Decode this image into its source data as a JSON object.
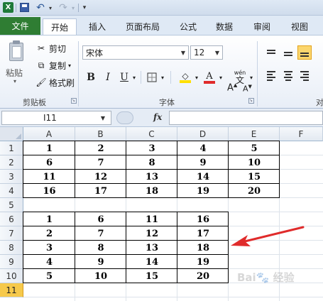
{
  "quick_access": {
    "logo": "X",
    "undo_icon": "undo-icon",
    "redo_icon": "redo-icon"
  },
  "tabs": {
    "file": "文件",
    "items": [
      "开始",
      "插入",
      "页面布局",
      "公式",
      "数据",
      "审阅",
      "视图"
    ],
    "active": "开始"
  },
  "ribbon": {
    "clipboard": {
      "paste": "粘贴",
      "cut": "剪切",
      "copy": "复制",
      "copy_dropdown": "▾",
      "format_painter": "格式刷",
      "group_label": "剪贴板"
    },
    "font": {
      "font_name": "宋体",
      "font_size": "12",
      "grow": "A",
      "shrink": "A",
      "bold": "B",
      "italic": "I",
      "underline": "U",
      "fill_letter": "A",
      "phonetic": "wén",
      "phonetic_char": "文",
      "group_label": "字体"
    },
    "alignment": {
      "group_label_partial": "对"
    }
  },
  "formula_bar": {
    "name_box": "I11",
    "fx": "fx",
    "value": ""
  },
  "sheet": {
    "columns": [
      "A",
      "B",
      "C",
      "D",
      "E",
      "F"
    ],
    "rows": [
      "1",
      "2",
      "3",
      "4",
      "5",
      "6",
      "7",
      "8",
      "9",
      "10",
      "11"
    ],
    "selected_row": "11",
    "table1": [
      [
        "1",
        "2",
        "3",
        "4",
        "5"
      ],
      [
        "6",
        "7",
        "8",
        "9",
        "10"
      ],
      [
        "11",
        "12",
        "13",
        "14",
        "15"
      ],
      [
        "16",
        "17",
        "18",
        "19",
        "20"
      ]
    ],
    "table2": [
      [
        "1",
        "6",
        "11",
        "16"
      ],
      [
        "2",
        "7",
        "12",
        "17"
      ],
      [
        "3",
        "8",
        "13",
        "18"
      ],
      [
        "4",
        "9",
        "14",
        "19"
      ],
      [
        "5",
        "10",
        "15",
        "20"
      ]
    ]
  },
  "colors": {
    "file_tab": "#2f7d33",
    "selected_row": "#f6c94b",
    "arrow": "#e02b2b",
    "underline_red": "#e02b2b",
    "fill_yellow": "#ffe000"
  }
}
